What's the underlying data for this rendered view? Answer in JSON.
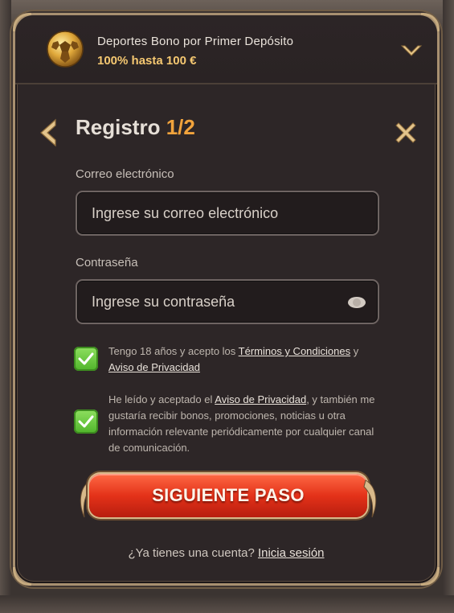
{
  "bonus": {
    "title": "Deportes Bono por Primer Depósito",
    "amount": "100% hasta 100 €"
  },
  "header": {
    "title": "Registro ",
    "step_current": "1",
    "step_total": "/2"
  },
  "email": {
    "label": "Correo electrónico",
    "placeholder": "Ingrese su correo electrónico",
    "value": ""
  },
  "password": {
    "label": "Contraseña",
    "placeholder": "Ingrese su contraseña",
    "value": ""
  },
  "consents": [
    {
      "checked": true,
      "text_before": "Tengo 18 años y acepto los ",
      "link1": "Términos y Condiciones",
      "text_mid": " y",
      "link2": "Aviso de Privacidad"
    },
    {
      "checked": true,
      "text_before": "He leído y aceptado el ",
      "link1": "Aviso de Privacidad",
      "text_after": ", y también me gustaría recibir bonos, promociones, noticias u otra información relevante periódicamente por cualquier canal de comunicación."
    }
  ],
  "next_button": {
    "label": "SIGUIENTE PASO"
  },
  "login_prompt": {
    "text": "¿Ya tienes una cuenta? ",
    "link": "Inicia sesión"
  },
  "colors": {
    "accent_orange": "#f1a33c",
    "bonus_gold": "#f5c871",
    "checkbox_green": "#5cc233",
    "button_red": "#e43219"
  },
  "icons": {
    "bonus": "soccer-ball-icon",
    "expand": "chevron-down-icon",
    "back": "chevron-left-icon",
    "close": "close-icon",
    "password_toggle": "eye-icon",
    "check": "check-icon"
  }
}
